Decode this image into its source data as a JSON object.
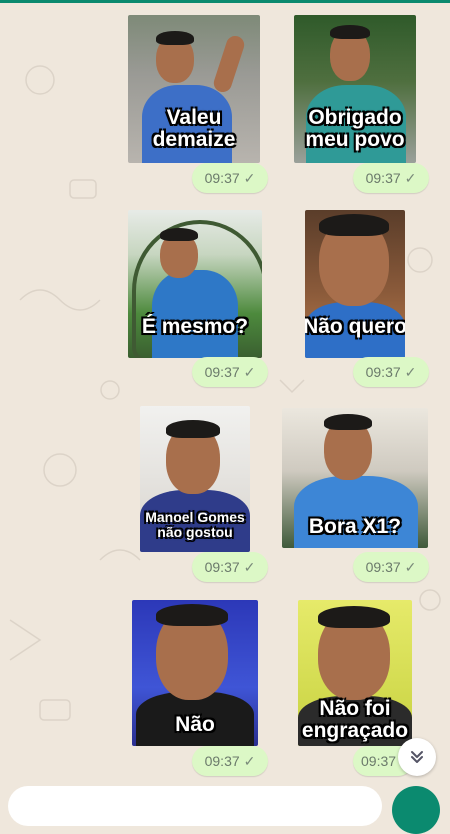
{
  "messages": [
    {
      "caption": "Valeu\ndemaize",
      "time": "09:37"
    },
    {
      "caption": "Obrigado\nmeu povo",
      "time": "09:37"
    },
    {
      "caption": "É mesmo?",
      "time": "09:37"
    },
    {
      "caption": "Não quero",
      "time": "09:37"
    },
    {
      "caption": "Manoel Gomes\nnão gostou",
      "time": "09:37"
    },
    {
      "caption": "Bora X1?",
      "time": "09:37"
    },
    {
      "caption": "Não",
      "time": "09:37"
    },
    {
      "caption": "Não foi\nengraçado",
      "time": "09:37"
    }
  ],
  "icons": {
    "read_receipt": "checkmark-icon",
    "scroll_down": "double-chevron-down-icon"
  },
  "colors": {
    "accent": "#0b8a6f",
    "bubble": "#dcf8c6",
    "wallpaper": "#efe7dc"
  }
}
